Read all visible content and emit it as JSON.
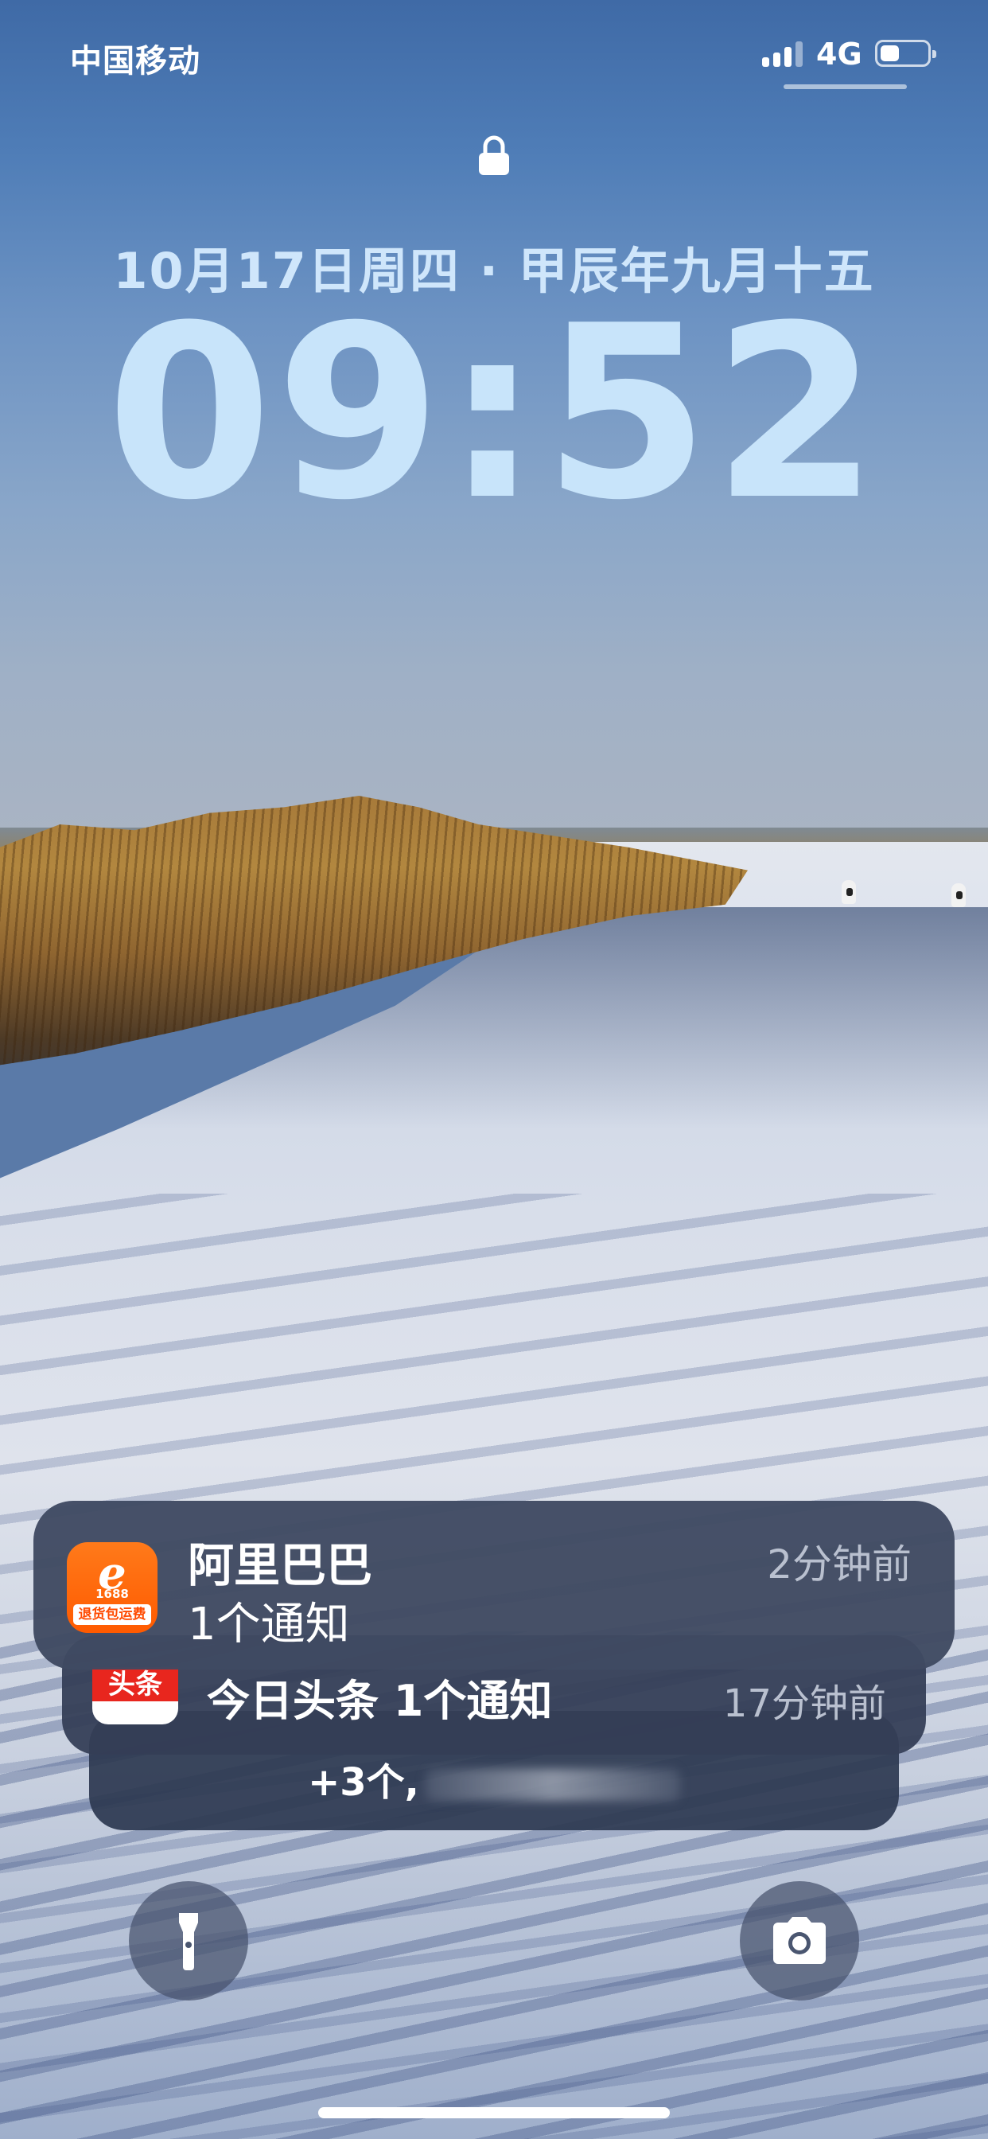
{
  "status_bar": {
    "carrier": "中国移动",
    "network": "4G",
    "signal_bars_active": 3,
    "signal_bars_total": 4,
    "battery_level": 0.4
  },
  "lock_screen": {
    "date": "10月17日周四 · 甲辰年九月十五",
    "time": "09:52",
    "lock_icon": "lock-icon",
    "text_color": "#c8e4fa"
  },
  "notifications": {
    "main": {
      "app_icon": "alibaba-1688-icon",
      "icon_text_logo": "e",
      "icon_text_number": "1688",
      "icon_text_banner": "退货包运费",
      "title": "阿里巴巴",
      "body": "1个通知",
      "time": "2分钟前"
    },
    "second": {
      "app_icon": "toutiao-icon",
      "icon_text": "头条",
      "text": "今日头条 1个通知",
      "time": "17分钟前"
    },
    "more": {
      "text": "+3个,"
    }
  },
  "quick_actions": {
    "left": "flashlight-icon",
    "right": "camera-icon"
  }
}
